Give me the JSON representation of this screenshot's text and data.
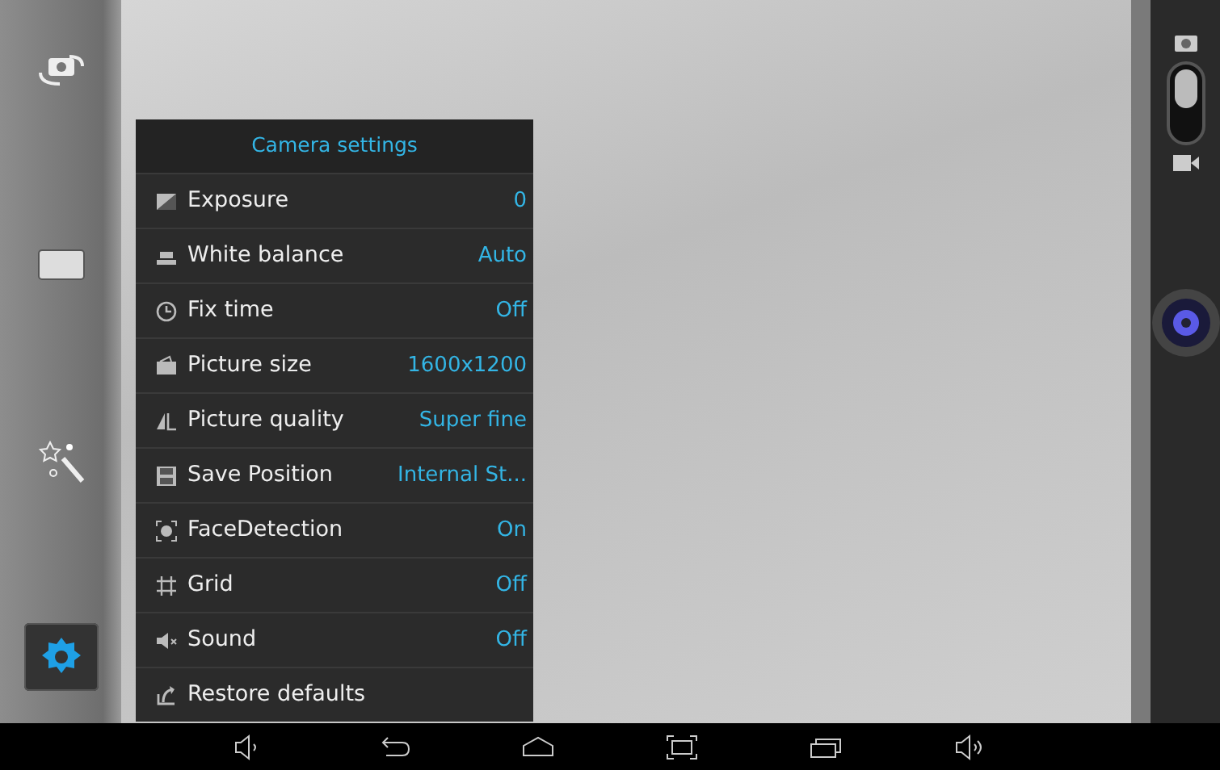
{
  "left_toolbar": [
    {
      "selected": false
    },
    {
      "selected": false
    },
    {
      "selected": false
    },
    {
      "selected": true
    }
  ],
  "settings": {
    "title": "Camera settings",
    "items": [
      {
        "label": "Exposure",
        "value": "0"
      },
      {
        "label": "White balance",
        "value": "Auto"
      },
      {
        "label": "Fix time",
        "value": "Off"
      },
      {
        "label": "Picture size",
        "value": "1600x1200"
      },
      {
        "label": "Picture quality",
        "value": "Super fine"
      },
      {
        "label": "Save Position",
        "value": "Internal St..."
      },
      {
        "label": "FaceDetection",
        "value": "On"
      },
      {
        "label": "Grid",
        "value": "Off"
      },
      {
        "label": "Sound",
        "value": "Off"
      },
      {
        "label": "Restore defaults"
      }
    ]
  },
  "mode_switch": {
    "on": false
  }
}
